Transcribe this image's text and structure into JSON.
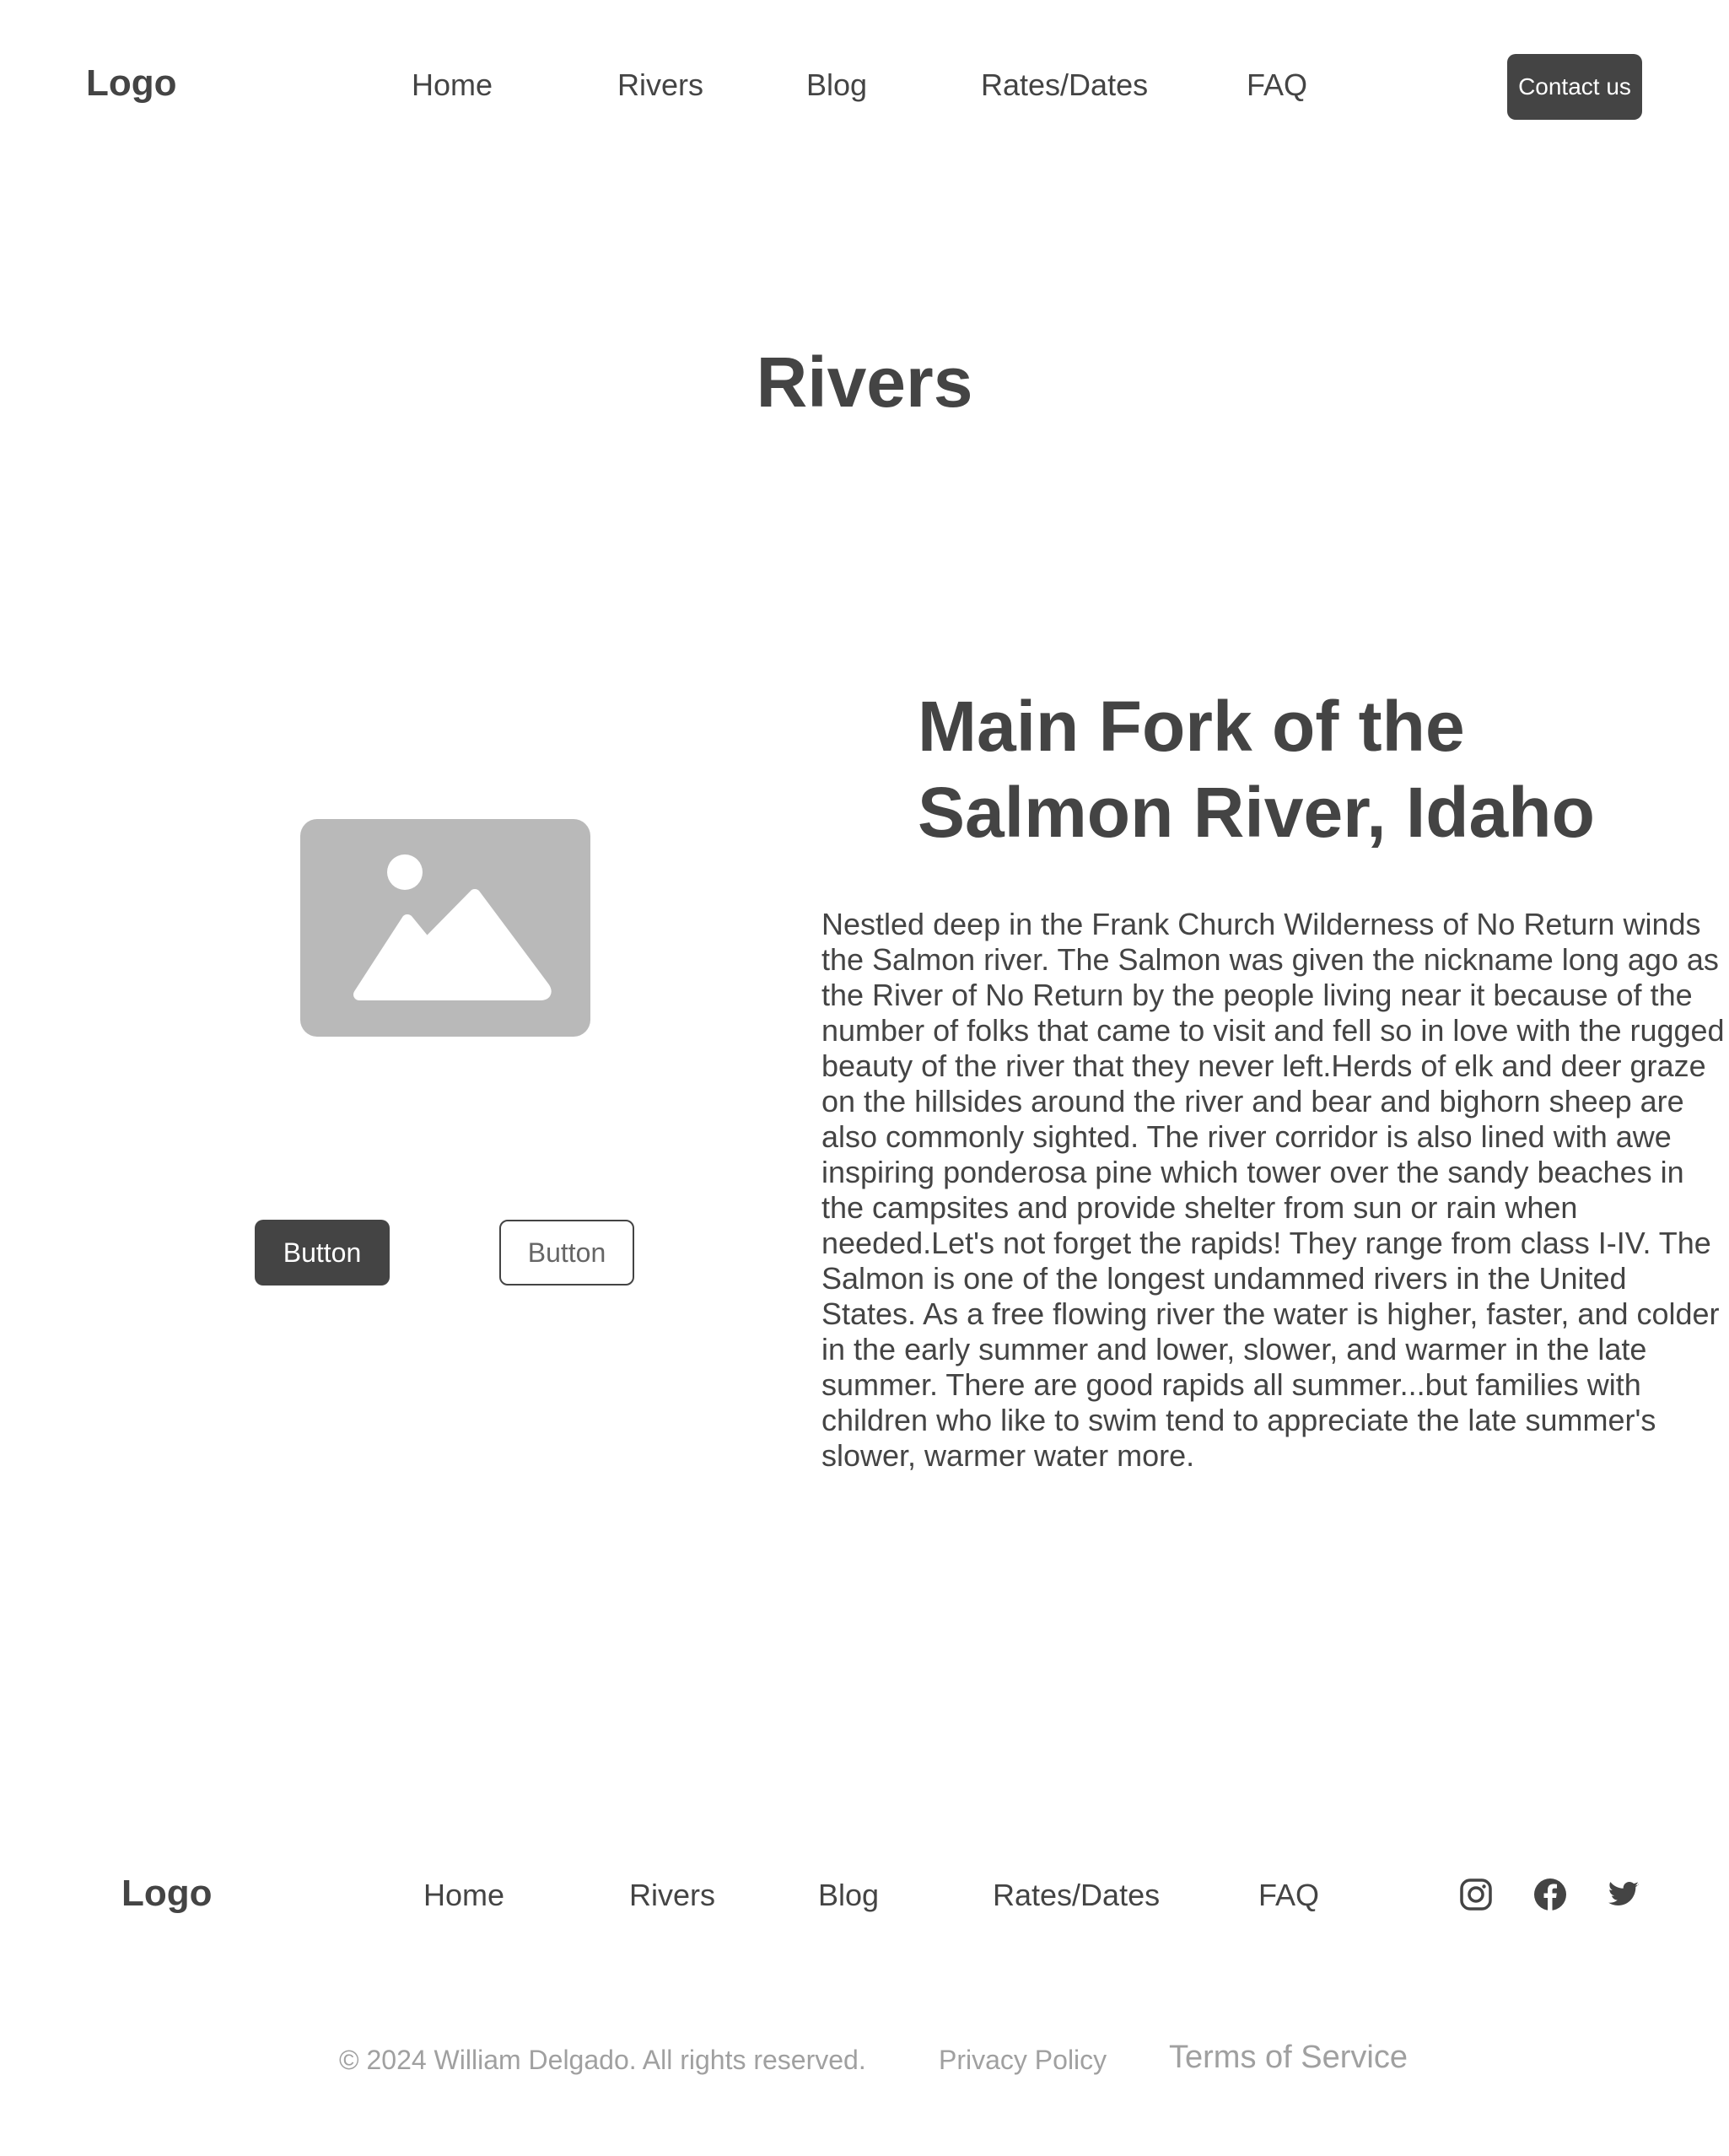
{
  "header": {
    "logo": "Logo",
    "nav": [
      "Home",
      "Rivers",
      "Blog",
      "Rates/Dates",
      "FAQ"
    ],
    "contact_label": "Contact us"
  },
  "main": {
    "title": "Rivers",
    "image_icon": "image-placeholder-icon",
    "primary_button": "Button",
    "secondary_button": "Button",
    "article_heading": "Main Fork of the Salmon River, Idaho",
    "article_body": "Nestled deep in the Frank Church Wilderness of No Return winds the Salmon river. The Salmon was given the nickname long ago as the River of No Return by the people living near it because of the number of folks that came to visit and fell so in love with the rugged beauty of the river that they never left.Herds of elk and deer graze on the hillsides around the river and bear and bighorn sheep are also commonly sighted. The river corridor is also lined with awe inspiring ponderosa pine which tower over the sandy beaches in the campsites and provide shelter from sun or rain when needed.Let's not forget the rapids! They range from class I-IV. The Salmon is one of the longest undammed rivers in the United States. As a free flowing river the water is higher, faster, and colder in the early summer and lower, slower, and warmer in the late summer. There are good rapids all summer...but families with children who like to swim tend to appreciate the late summer's slower, warmer water more."
  },
  "footer": {
    "logo": "Logo",
    "nav": [
      "Home",
      "Rivers",
      "Blog",
      "Rates/Dates",
      "FAQ"
    ],
    "social_icons": [
      "instagram-icon",
      "facebook-icon",
      "twitter-icon"
    ],
    "copyright": "© 2024 William Delgado. All rights reserved.",
    "privacy": "Privacy Policy",
    "terms": "Terms of Service"
  },
  "colors": {
    "primary": "#444444",
    "placeholder": "#b9b9b9",
    "muted": "#a0a0a0",
    "background": "#ffffff"
  }
}
